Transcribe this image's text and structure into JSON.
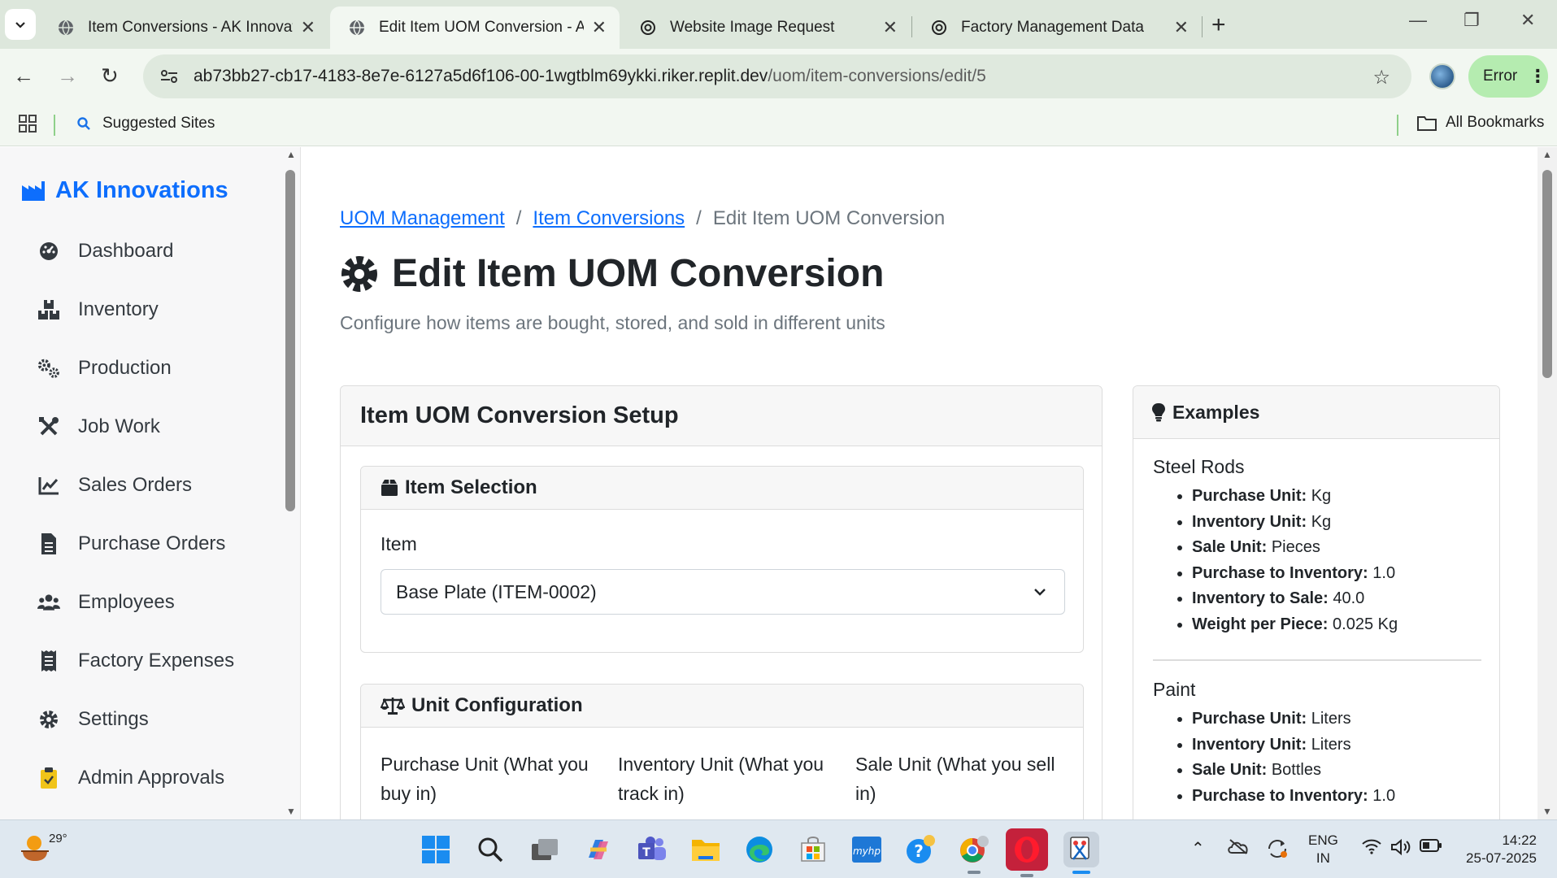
{
  "browser": {
    "tabs": [
      {
        "title": "Item Conversions - AK Innovations",
        "active": false,
        "favicon": "globe-icon"
      },
      {
        "title": "Edit Item UOM Conversion - AK Innovations",
        "active": true,
        "favicon": "globe-icon"
      },
      {
        "title": "Website Image Request",
        "active": false,
        "favicon": "openai-icon"
      },
      {
        "title": "Factory Management Data",
        "active": false,
        "favicon": "openai-icon"
      }
    ],
    "url_host": "ab73bb27-cb17-4183-8e7e-6127a5d6f106-00-1wgtblm69ykki.riker.replit.dev",
    "url_path": "/uom/item-conversions/edit/5",
    "profile_status": "Error",
    "bookmarks": {
      "suggested": "Suggested Sites",
      "all": "All Bookmarks"
    }
  },
  "sidebar": {
    "brand": "AK Innovations",
    "items": [
      {
        "label": "Dashboard",
        "icon": "dashboard-icon"
      },
      {
        "label": "Inventory",
        "icon": "boxes-icon"
      },
      {
        "label": "Production",
        "icon": "cogs-icon"
      },
      {
        "label": "Job Work",
        "icon": "tools-icon"
      },
      {
        "label": "Sales Orders",
        "icon": "chart-line-icon"
      },
      {
        "label": "Purchase Orders",
        "icon": "file-icon"
      },
      {
        "label": "Employees",
        "icon": "users-icon"
      },
      {
        "label": "Factory Expenses",
        "icon": "receipt-icon"
      },
      {
        "label": "Settings",
        "icon": "gear-icon"
      },
      {
        "label": "Admin Approvals",
        "icon": "clipboard-check-icon"
      }
    ]
  },
  "breadcrumb": {
    "items": [
      "UOM Management",
      "Item Conversions"
    ],
    "current": "Edit Item UOM Conversion",
    "separator": "/"
  },
  "page": {
    "title": "Edit Item UOM Conversion",
    "subtitle": "Configure how items are bought, stored, and sold in different units"
  },
  "setup": {
    "title": "Item UOM Conversion Setup",
    "item_selection": {
      "title": "Item Selection",
      "label": "Item",
      "value": "Base Plate (ITEM-0002)"
    },
    "unit_configuration": {
      "title": "Unit Configuration",
      "purchase_label": "Purchase Unit (What you buy in)",
      "inventory_label": "Inventory Unit (What you track in)",
      "sale_label": "Sale Unit (What you sell in)"
    }
  },
  "examples": {
    "title": "Examples",
    "sections": [
      {
        "name": "Steel Rods",
        "rows": [
          {
            "key": "Purchase Unit:",
            "value": "Kg"
          },
          {
            "key": "Inventory Unit:",
            "value": "Kg"
          },
          {
            "key": "Sale Unit:",
            "value": "Pieces"
          },
          {
            "key": "Purchase to Inventory:",
            "value": "1.0"
          },
          {
            "key": "Inventory to Sale:",
            "value": "40.0"
          },
          {
            "key": "Weight per Piece:",
            "value": "0.025 Kg"
          }
        ]
      },
      {
        "name": "Paint",
        "rows": [
          {
            "key": "Purchase Unit:",
            "value": "Liters"
          },
          {
            "key": "Inventory Unit:",
            "value": "Liters"
          },
          {
            "key": "Sale Unit:",
            "value": "Bottles"
          },
          {
            "key": "Purchase to Inventory:",
            "value": "1.0"
          }
        ]
      }
    ]
  },
  "taskbar": {
    "weather_temp": "29°",
    "lang_primary": "ENG",
    "lang_secondary": "IN",
    "time": "14:22",
    "date": "25-07-2025"
  },
  "colors": {
    "accent": "#0d6efd",
    "tab_strip": "#dde7dc",
    "toolbar": "#f2f7f1",
    "error_chip": "#b5ecb0"
  }
}
